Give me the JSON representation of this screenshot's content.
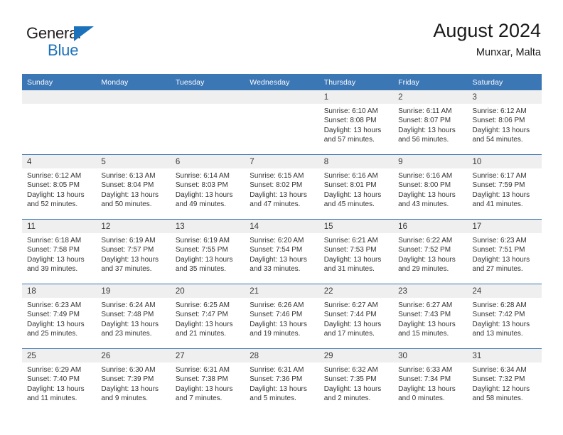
{
  "brand": {
    "name_part1": "General",
    "name_part2": "Blue",
    "triangle_color": "#1b72bb"
  },
  "header": {
    "title": "August 2024",
    "location": "Munxar, Malta"
  },
  "theme": {
    "header_blue": "#3b76b5",
    "daynum_gray": "#efefef",
    "text_color": "#333333",
    "brand_blue": "#1b72bb"
  },
  "weekday_headers": [
    "Sunday",
    "Monday",
    "Tuesday",
    "Wednesday",
    "Thursday",
    "Friday",
    "Saturday"
  ],
  "weeks": [
    [
      {
        "day": "",
        "empty": true,
        "sunrise": "",
        "sunset": "",
        "daylight1": "",
        "daylight2": ""
      },
      {
        "day": "",
        "empty": true,
        "sunrise": "",
        "sunset": "",
        "daylight1": "",
        "daylight2": ""
      },
      {
        "day": "",
        "empty": true,
        "sunrise": "",
        "sunset": "",
        "daylight1": "",
        "daylight2": ""
      },
      {
        "day": "",
        "empty": true,
        "sunrise": "",
        "sunset": "",
        "daylight1": "",
        "daylight2": ""
      },
      {
        "day": "1",
        "empty": false,
        "sunrise": "Sunrise: 6:10 AM",
        "sunset": "Sunset: 8:08 PM",
        "daylight1": "Daylight: 13 hours",
        "daylight2": "and 57 minutes."
      },
      {
        "day": "2",
        "empty": false,
        "sunrise": "Sunrise: 6:11 AM",
        "sunset": "Sunset: 8:07 PM",
        "daylight1": "Daylight: 13 hours",
        "daylight2": "and 56 minutes."
      },
      {
        "day": "3",
        "empty": false,
        "sunrise": "Sunrise: 6:12 AM",
        "sunset": "Sunset: 8:06 PM",
        "daylight1": "Daylight: 13 hours",
        "daylight2": "and 54 minutes."
      }
    ],
    [
      {
        "day": "4",
        "empty": false,
        "sunrise": "Sunrise: 6:12 AM",
        "sunset": "Sunset: 8:05 PM",
        "daylight1": "Daylight: 13 hours",
        "daylight2": "and 52 minutes."
      },
      {
        "day": "5",
        "empty": false,
        "sunrise": "Sunrise: 6:13 AM",
        "sunset": "Sunset: 8:04 PM",
        "daylight1": "Daylight: 13 hours",
        "daylight2": "and 50 minutes."
      },
      {
        "day": "6",
        "empty": false,
        "sunrise": "Sunrise: 6:14 AM",
        "sunset": "Sunset: 8:03 PM",
        "daylight1": "Daylight: 13 hours",
        "daylight2": "and 49 minutes."
      },
      {
        "day": "7",
        "empty": false,
        "sunrise": "Sunrise: 6:15 AM",
        "sunset": "Sunset: 8:02 PM",
        "daylight1": "Daylight: 13 hours",
        "daylight2": "and 47 minutes."
      },
      {
        "day": "8",
        "empty": false,
        "sunrise": "Sunrise: 6:16 AM",
        "sunset": "Sunset: 8:01 PM",
        "daylight1": "Daylight: 13 hours",
        "daylight2": "and 45 minutes."
      },
      {
        "day": "9",
        "empty": false,
        "sunrise": "Sunrise: 6:16 AM",
        "sunset": "Sunset: 8:00 PM",
        "daylight1": "Daylight: 13 hours",
        "daylight2": "and 43 minutes."
      },
      {
        "day": "10",
        "empty": false,
        "sunrise": "Sunrise: 6:17 AM",
        "sunset": "Sunset: 7:59 PM",
        "daylight1": "Daylight: 13 hours",
        "daylight2": "and 41 minutes."
      }
    ],
    [
      {
        "day": "11",
        "empty": false,
        "sunrise": "Sunrise: 6:18 AM",
        "sunset": "Sunset: 7:58 PM",
        "daylight1": "Daylight: 13 hours",
        "daylight2": "and 39 minutes."
      },
      {
        "day": "12",
        "empty": false,
        "sunrise": "Sunrise: 6:19 AM",
        "sunset": "Sunset: 7:57 PM",
        "daylight1": "Daylight: 13 hours",
        "daylight2": "and 37 minutes."
      },
      {
        "day": "13",
        "empty": false,
        "sunrise": "Sunrise: 6:19 AM",
        "sunset": "Sunset: 7:55 PM",
        "daylight1": "Daylight: 13 hours",
        "daylight2": "and 35 minutes."
      },
      {
        "day": "14",
        "empty": false,
        "sunrise": "Sunrise: 6:20 AM",
        "sunset": "Sunset: 7:54 PM",
        "daylight1": "Daylight: 13 hours",
        "daylight2": "and 33 minutes."
      },
      {
        "day": "15",
        "empty": false,
        "sunrise": "Sunrise: 6:21 AM",
        "sunset": "Sunset: 7:53 PM",
        "daylight1": "Daylight: 13 hours",
        "daylight2": "and 31 minutes."
      },
      {
        "day": "16",
        "empty": false,
        "sunrise": "Sunrise: 6:22 AM",
        "sunset": "Sunset: 7:52 PM",
        "daylight1": "Daylight: 13 hours",
        "daylight2": "and 29 minutes."
      },
      {
        "day": "17",
        "empty": false,
        "sunrise": "Sunrise: 6:23 AM",
        "sunset": "Sunset: 7:51 PM",
        "daylight1": "Daylight: 13 hours",
        "daylight2": "and 27 minutes."
      }
    ],
    [
      {
        "day": "18",
        "empty": false,
        "sunrise": "Sunrise: 6:23 AM",
        "sunset": "Sunset: 7:49 PM",
        "daylight1": "Daylight: 13 hours",
        "daylight2": "and 25 minutes."
      },
      {
        "day": "19",
        "empty": false,
        "sunrise": "Sunrise: 6:24 AM",
        "sunset": "Sunset: 7:48 PM",
        "daylight1": "Daylight: 13 hours",
        "daylight2": "and 23 minutes."
      },
      {
        "day": "20",
        "empty": false,
        "sunrise": "Sunrise: 6:25 AM",
        "sunset": "Sunset: 7:47 PM",
        "daylight1": "Daylight: 13 hours",
        "daylight2": "and 21 minutes."
      },
      {
        "day": "21",
        "empty": false,
        "sunrise": "Sunrise: 6:26 AM",
        "sunset": "Sunset: 7:46 PM",
        "daylight1": "Daylight: 13 hours",
        "daylight2": "and 19 minutes."
      },
      {
        "day": "22",
        "empty": false,
        "sunrise": "Sunrise: 6:27 AM",
        "sunset": "Sunset: 7:44 PM",
        "daylight1": "Daylight: 13 hours",
        "daylight2": "and 17 minutes."
      },
      {
        "day": "23",
        "empty": false,
        "sunrise": "Sunrise: 6:27 AM",
        "sunset": "Sunset: 7:43 PM",
        "daylight1": "Daylight: 13 hours",
        "daylight2": "and 15 minutes."
      },
      {
        "day": "24",
        "empty": false,
        "sunrise": "Sunrise: 6:28 AM",
        "sunset": "Sunset: 7:42 PM",
        "daylight1": "Daylight: 13 hours",
        "daylight2": "and 13 minutes."
      }
    ],
    [
      {
        "day": "25",
        "empty": false,
        "sunrise": "Sunrise: 6:29 AM",
        "sunset": "Sunset: 7:40 PM",
        "daylight1": "Daylight: 13 hours",
        "daylight2": "and 11 minutes."
      },
      {
        "day": "26",
        "empty": false,
        "sunrise": "Sunrise: 6:30 AM",
        "sunset": "Sunset: 7:39 PM",
        "daylight1": "Daylight: 13 hours",
        "daylight2": "and 9 minutes."
      },
      {
        "day": "27",
        "empty": false,
        "sunrise": "Sunrise: 6:31 AM",
        "sunset": "Sunset: 7:38 PM",
        "daylight1": "Daylight: 13 hours",
        "daylight2": "and 7 minutes."
      },
      {
        "day": "28",
        "empty": false,
        "sunrise": "Sunrise: 6:31 AM",
        "sunset": "Sunset: 7:36 PM",
        "daylight1": "Daylight: 13 hours",
        "daylight2": "and 5 minutes."
      },
      {
        "day": "29",
        "empty": false,
        "sunrise": "Sunrise: 6:32 AM",
        "sunset": "Sunset: 7:35 PM",
        "daylight1": "Daylight: 13 hours",
        "daylight2": "and 2 minutes."
      },
      {
        "day": "30",
        "empty": false,
        "sunrise": "Sunrise: 6:33 AM",
        "sunset": "Sunset: 7:34 PM",
        "daylight1": "Daylight: 13 hours",
        "daylight2": "and 0 minutes."
      },
      {
        "day": "31",
        "empty": false,
        "sunrise": "Sunrise: 6:34 AM",
        "sunset": "Sunset: 7:32 PM",
        "daylight1": "Daylight: 12 hours",
        "daylight2": "and 58 minutes."
      }
    ]
  ]
}
